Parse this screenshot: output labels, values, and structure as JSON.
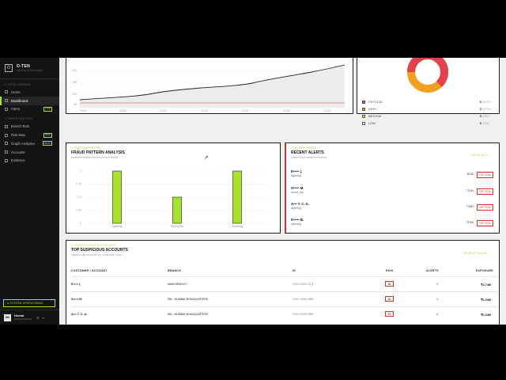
{
  "brand": {
    "title": "O-TEN",
    "subtitle": "FRAUD PLATFORM",
    "mark": "O"
  },
  "nav": {
    "section_intel": "// INTELLIGENCE",
    "section_invest": "// INVESTIGATION",
    "items": [
      {
        "label": "Home",
        "badge": ""
      },
      {
        "label": "Dashboard",
        "badge": ""
      },
      {
        "label": "Alerts",
        "badge": "LIVE"
      },
      {
        "label": "Branch Risk",
        "badge": ""
      },
      {
        "label": "Risk Map",
        "badge": "NEW"
      },
      {
        "label": "Graph Analytics",
        "badge": "BETA"
      },
      {
        "label": "Accounts",
        "badge": ""
      },
      {
        "label": "Evidence",
        "badge": ""
      }
    ]
  },
  "system_status": "● SYSTEM OPERATIONAL",
  "user": {
    "initials": "INV",
    "name": "Nomal",
    "role": "INVESTIGATOR"
  },
  "trend_chart": {
    "yticks": [
      "200",
      "150",
      "100",
      "50"
    ],
    "xticks": [
      "09:00",
      "09:30",
      "10:00",
      "10:30",
      "11:00",
      "11:30",
      "12:00"
    ]
  },
  "severity": {
    "rows": [
      {
        "label": "CRITICAL",
        "value": "5",
        "pct": "(63%)",
        "color": "#e2414d"
      },
      {
        "label": "HIGH",
        "value": "3",
        "pct": "(37%)",
        "color": "#f0a020"
      },
      {
        "label": "MEDIUM",
        "value": "0",
        "pct": "(0%)",
        "color": "#f5e04a"
      },
      {
        "label": "LOW",
        "value": "0",
        "pct": "(0%)",
        "color": "#ffffff"
      }
    ]
  },
  "fraud_pattern": {
    "label": "// PATTERN INTEL",
    "title": "FRAUD PATTERN ANALYSIS",
    "subtitle": "Detected pattern frequency this period",
    "chart_data": {
      "type": "bar",
      "categories": [
        "Layering",
        "Round Trip",
        "Smurfing"
      ],
      "values": [
        1,
        0.5,
        1
      ],
      "yticks": [
        "1",
        "0.75",
        "0.5",
        "0.25",
        "0"
      ],
      "ylim": [
        0,
        1
      ],
      "color": "#a6e22e"
    }
  },
  "recent_alerts": {
    "label": "// ALERT FEED",
    "title": "RECENT ALERTS",
    "subtitle": "Latest fraud detection events",
    "view_all": "VIEW ALL →",
    "items": [
      {
        "name": "E••••• (.",
        "type": "layering",
        "time": "NOW",
        "severity": "CRITICAL"
      },
      {
        "name": "S••••• M.",
        "type": "round_trip",
        "time": "T3:3H",
        "severity": "CRITICAL"
      },
      {
        "name": "A••• T. C. A.",
        "type": "layering",
        "time": "T3:6H",
        "severity": "CRITICAL"
      },
      {
        "name": "K••••• B.",
        "type": "layering",
        "time": "T3:5M",
        "severity": "CRITICAL"
      }
    ]
  },
  "suspicious": {
    "label": "// SUSPICIOUS ACCOUNTS",
    "title": "TOP SUSPICIOUS ACCOUNTS",
    "subtitle": "Highest risk accounts by composite score",
    "investigate": "INVESTIGATE →",
    "headers": [
      "CUSTOMER / ACCOUNT",
      "BRANCH",
      "ID",
      "RISK",
      "ALERTS",
      "EXPOSURE"
    ],
    "rows": [
      {
        "customer": "E••••• (.",
        "branch": "MAIN BRANCH",
        "id": "XXXX-XXXX-19_8",
        "risk": "86",
        "alerts": "1",
        "exposure": "₹4.74M"
      },
      {
        "customer": "S••••• M.",
        "branch": "SBI - MUMBAI HEADQUARTERS",
        "id": "XXXX-XXXX-4890",
        "risk": "86",
        "alerts": "1",
        "exposure": "₹0.03M"
      },
      {
        "customer": "A••• T. C. A.",
        "branch": "SBI - MUMBAI HEADQUARTERS",
        "id": "XXXX-XXXX-4890",
        "risk": "87",
        "alerts": "1",
        "exposure": "₹0.04M"
      }
    ]
  }
}
